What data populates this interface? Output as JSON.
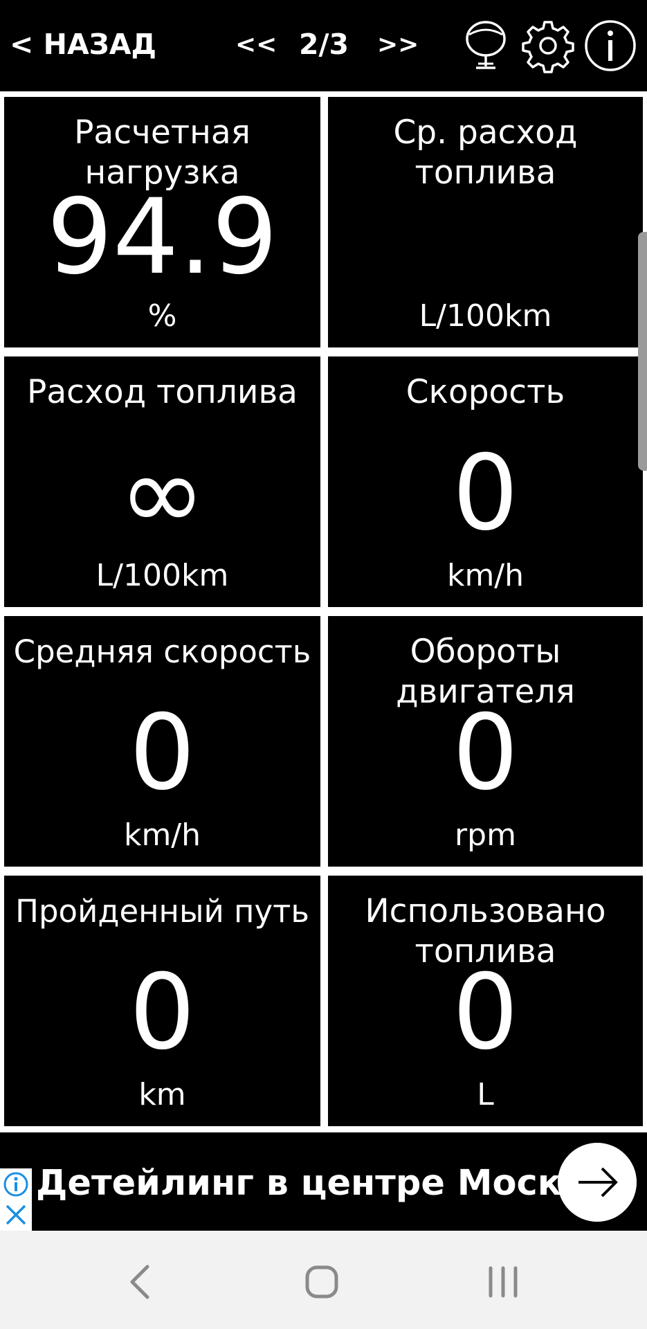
{
  "topbar": {
    "back_label": "< НАЗАД",
    "prev_label": "<<",
    "page_indicator": "2/3",
    "next_label": ">>",
    "icons": [
      "microphone-icon",
      "gear-icon",
      "info-icon"
    ]
  },
  "tiles": [
    {
      "label": "Расчетная нагрузка",
      "value": "94.9",
      "unit": "%"
    },
    {
      "label": "Ср. расход топлива",
      "value": "",
      "unit": "L/100km"
    },
    {
      "label": "Расход топлива",
      "value": "∞",
      "unit": "L/100km"
    },
    {
      "label": "Скорость",
      "value": "0",
      "unit": "km/h"
    },
    {
      "label": "Средняя скорость",
      "value": "0",
      "unit": "km/h"
    },
    {
      "label": "Обороты двигателя",
      "value": "0",
      "unit": "rpm"
    },
    {
      "label": "Пройденный путь",
      "value": "0",
      "unit": "km"
    },
    {
      "label": "Использовано топлива",
      "value": "0",
      "unit": "L"
    }
  ],
  "ad": {
    "text": "Детейлинг в центре Москвы",
    "icons": [
      "ad-info-icon",
      "ad-close-icon",
      "arrow-right-icon"
    ],
    "accent": "#1a8fe3"
  },
  "system_nav": {
    "icons": [
      "back-chevron-icon",
      "home-icon",
      "recents-icon"
    ]
  },
  "colors": {
    "background": "#000000",
    "foreground": "#ffffff",
    "separator": "#ffffff"
  }
}
